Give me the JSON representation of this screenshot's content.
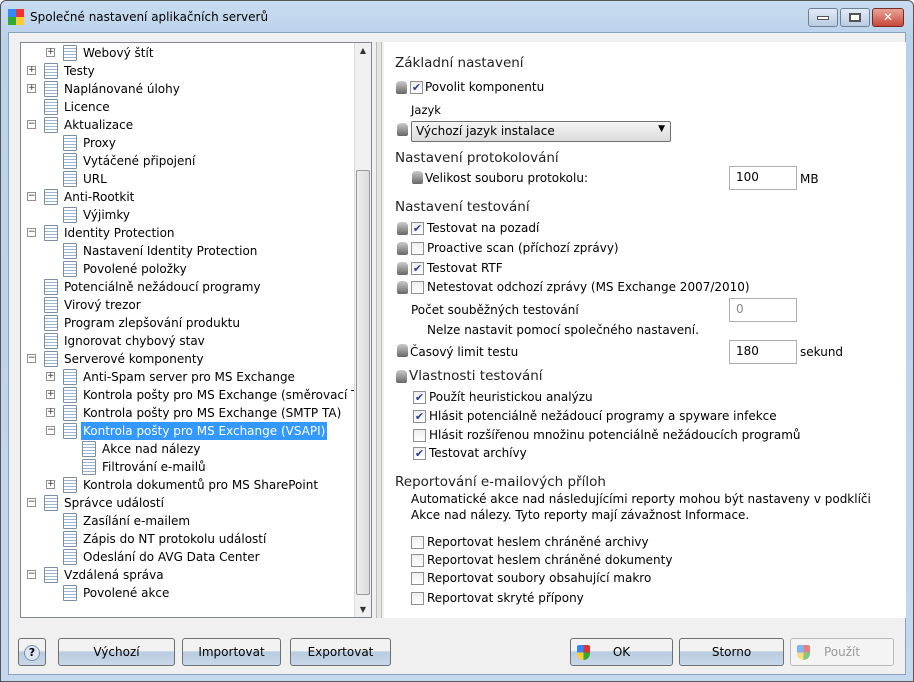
{
  "window": {
    "title": "Společné nastavení aplikačních serverů",
    "colors": {
      "selection": "#3399ff",
      "close": "#c8473a"
    }
  },
  "tree": [
    {
      "level": 2,
      "exp": "+",
      "label": "Webový štít"
    },
    {
      "level": 1,
      "exp": "+",
      "label": "Testy",
      "icon": "search-icon"
    },
    {
      "level": 1,
      "exp": "+",
      "label": "Naplánované úlohy",
      "icon": "schedule-icon"
    },
    {
      "level": 1,
      "exp": "",
      "label": "Licence"
    },
    {
      "level": 1,
      "exp": "-",
      "label": "Aktualizace"
    },
    {
      "level": 2,
      "exp": "",
      "label": "Proxy"
    },
    {
      "level": 2,
      "exp": "",
      "label": "Vytáčené připojení"
    },
    {
      "level": 2,
      "exp": "",
      "label": "URL"
    },
    {
      "level": 1,
      "exp": "-",
      "label": "Anti-Rootkit"
    },
    {
      "level": 2,
      "exp": "",
      "label": "Výjimky"
    },
    {
      "level": 1,
      "exp": "-",
      "label": "Identity Protection"
    },
    {
      "level": 2,
      "exp": "",
      "label": "Nastavení Identity Protection"
    },
    {
      "level": 2,
      "exp": "",
      "label": "Povolené položky"
    },
    {
      "level": 1,
      "exp": "",
      "label": "Potenciálně nežádoucí programy"
    },
    {
      "level": 1,
      "exp": "",
      "label": "Virový trezor"
    },
    {
      "level": 1,
      "exp": "",
      "label": "Program zlepšování produktu"
    },
    {
      "level": 1,
      "exp": "",
      "label": "Ignorovat chybový stav"
    },
    {
      "level": 1,
      "exp": "-",
      "label": "Serverové komponenty"
    },
    {
      "level": 2,
      "exp": "+",
      "label": "Anti-Spam server pro MS Exchange"
    },
    {
      "level": 2,
      "exp": "+",
      "label": "Kontrola pošty pro MS Exchange (směrovací TA)"
    },
    {
      "level": 2,
      "exp": "+",
      "label": "Kontrola pošty pro MS Exchange (SMTP TA)"
    },
    {
      "level": 2,
      "exp": "-",
      "label": "Kontrola pošty pro MS Exchange (VSAPI)",
      "selected": true
    },
    {
      "level": 3,
      "exp": "",
      "label": "Akce nad nálezy"
    },
    {
      "level": 3,
      "exp": "",
      "label": "Filtrování e-mailů"
    },
    {
      "level": 2,
      "exp": "+",
      "label": "Kontrola dokumentů pro MS SharePoint"
    },
    {
      "level": 1,
      "exp": "-",
      "label": "Správce událostí"
    },
    {
      "level": 2,
      "exp": "",
      "label": "Zasílání e-mailem"
    },
    {
      "level": 2,
      "exp": "",
      "label": "Zápis do NT protokolu událostí"
    },
    {
      "level": 2,
      "exp": "",
      "label": "Odeslání do AVG Data Center"
    },
    {
      "level": 1,
      "exp": "-",
      "label": "Vzdálená správa"
    },
    {
      "level": 2,
      "exp": "",
      "label": "Povolené akce"
    }
  ],
  "basic": {
    "heading": "Základní nastavení",
    "enable": "Povolit komponentu",
    "enable_checked": true,
    "lang_label": "Jazyk",
    "lang_value": "Výchozí jazyk instalace"
  },
  "logging": {
    "heading": "Nastavení protokolování",
    "size_label": "Velikost souboru protokolu:",
    "size_value": "100",
    "unit": "MB"
  },
  "scan": {
    "heading": "Nastavení testování",
    "options": [
      {
        "label": "Testovat na pozadí",
        "checked": true
      },
      {
        "label": "Proactive scan (příchozí zprávy)",
        "checked": false
      },
      {
        "label": "Testovat RTF",
        "checked": true
      },
      {
        "label": "Netestovat odchozí zprávy (MS Exchange 2007/2010)",
        "checked": false
      }
    ],
    "concurrent_label": "Počet souběžných testování",
    "concurrent_value": "0",
    "concurrent_note": "Nelze nastavit pomocí společného nastavení.",
    "timeout_label": "Časový limit testu",
    "timeout_value": "180",
    "timeout_unit": "sekund"
  },
  "props": {
    "heading": "Vlastnosti testování",
    "options": [
      {
        "label": "Použít heuristickou analýzu",
        "checked": true
      },
      {
        "label": "Hlásit potenciálně nežádoucí programy a spyware infekce",
        "checked": true
      },
      {
        "label": "Hlásit rozšířenou množinu potenciálně nežádoucích programů",
        "checked": false
      },
      {
        "label": "Testovat archívy",
        "checked": true
      }
    ]
  },
  "reports": {
    "heading": "Reportování e-mailových příloh",
    "description": "Automatické akce nad následujícími reporty mohou být nastaveny v podklíči Akce nad nálezy. Tyto reporty mají závažnost Informace.",
    "options": [
      {
        "label": "Reportovat heslem chráněné archivy",
        "checked": false
      },
      {
        "label": "Reportovat heslem chráněné dokumenty",
        "checked": false
      },
      {
        "label": "Reportovat soubory obsahující makro",
        "checked": false
      },
      {
        "label": "Reportovat skryté přípony",
        "checked": false
      }
    ]
  },
  "buttons": {
    "help": "?",
    "default": "Výchozí",
    "import": "Importovat",
    "export": "Exportovat",
    "ok": "OK",
    "cancel": "Storno",
    "apply": "Použít"
  }
}
